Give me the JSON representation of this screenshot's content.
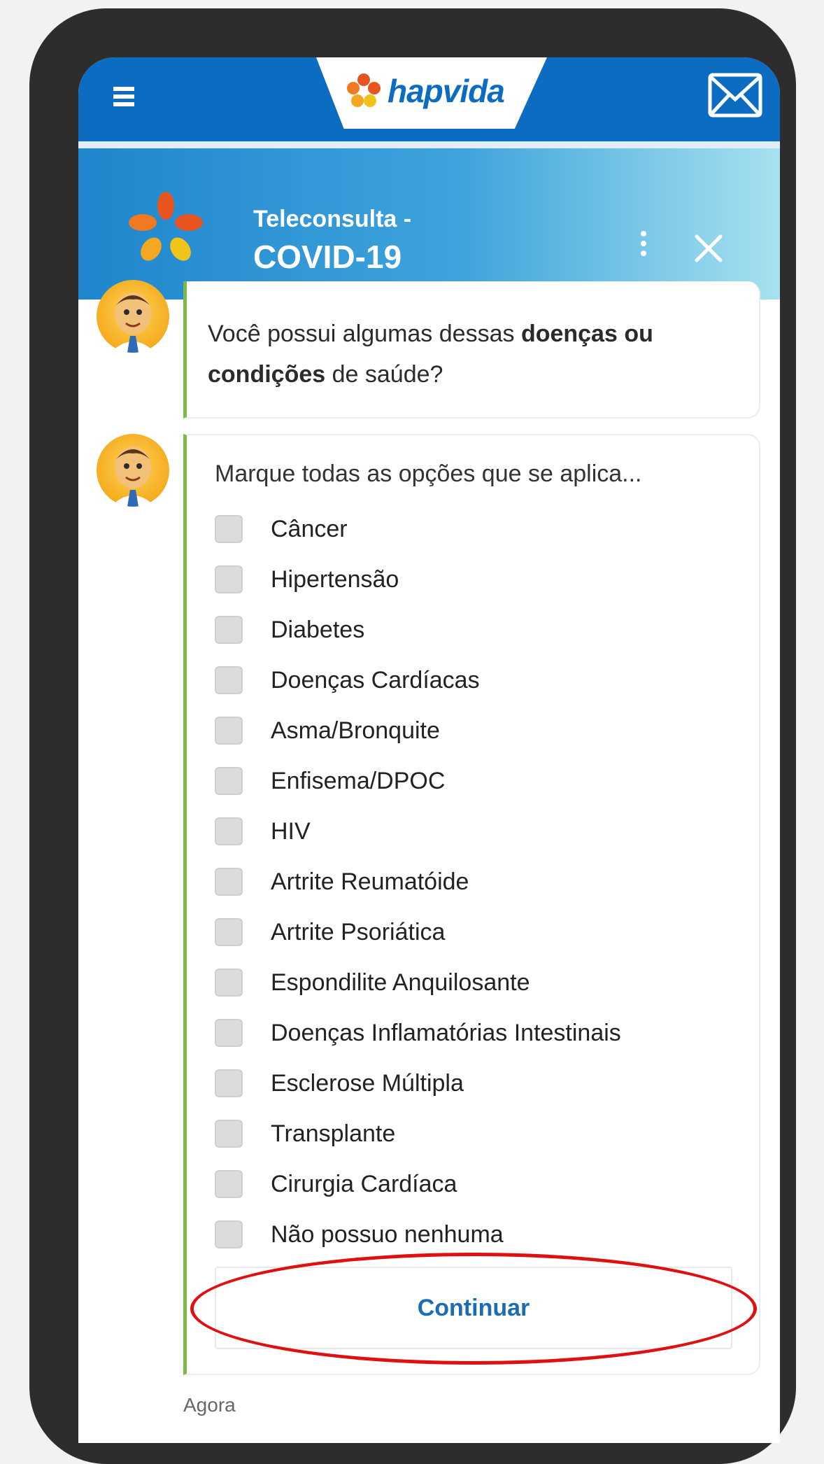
{
  "app": {
    "brand": "hapvida",
    "colors": {
      "app_bar": "#0b6cc2",
      "accent_green": "#7cbb4a",
      "highlight_red": "#e01010",
      "link_blue": "#1a6db5"
    }
  },
  "header": {
    "subtitle": "Teleconsulta -",
    "title": "COVID-19",
    "icons": [
      "menu-icon",
      "mail-icon",
      "kebab-icon",
      "close-icon"
    ]
  },
  "chat": {
    "question": {
      "prefix": "Você possui algumas dessas ",
      "bold_1": "doenças ou condições",
      "suffix": " de saúde?"
    },
    "instruction": "Marque todas as opções que se aplica...",
    "options": [
      "Câncer",
      "Hipertensão",
      "Diabetes",
      "Doenças Cardíacas",
      "Asma/Bronquite",
      "Enfisema/DPOC",
      "HIV",
      "Artrite Reumatóide",
      "Artrite Psoriática",
      "Espondilite Anquilosante",
      "Doenças Inflamatórias Intestinais",
      "Esclerose Múltipla",
      "Transplante",
      "Cirurgia Cardíaca",
      "Não possuo nenhuma"
    ],
    "continue_label": "Continuar",
    "timestamp": "Agora"
  }
}
